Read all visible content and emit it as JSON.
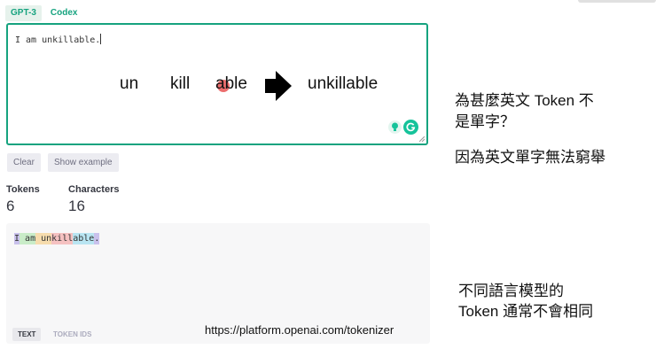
{
  "tabs": [
    {
      "label": "GPT-3"
    },
    {
      "label": "Codex"
    }
  ],
  "editor": {
    "text": "I am unkillable."
  },
  "annotation": {
    "parts": [
      "un",
      "kill",
      "able"
    ],
    "result": "unkillable"
  },
  "buttons": {
    "clear": "Clear",
    "show_example": "Show example"
  },
  "stats": {
    "tokens_label": "Tokens",
    "tokens_value": "6",
    "characters_label": "Characters",
    "characters_value": "16"
  },
  "tokens": [
    "I",
    " am",
    " un",
    "kill",
    "able",
    "."
  ],
  "view_tabs": {
    "text": "TEXT",
    "token_ids": "TOKEN IDS"
  },
  "tokenizer_url": "https://platform.openai.com/tokenizer",
  "slide": {
    "question_line1": "為甚麼英文 Token 不",
    "question_line2": "是單字？",
    "answer": "因為英文單字無法窮舉",
    "note_line1": "不同語言模型的",
    "note_line2": "Token 通常不會相同"
  },
  "colors": {
    "accent": "#16a37f",
    "grammarly": "#15c39a"
  },
  "icons": {
    "lightbulb": "lightbulb-icon",
    "grammarly": "grammarly-icon",
    "arrow": "right-arrow-icon",
    "resize": "resize-grip-icon"
  }
}
